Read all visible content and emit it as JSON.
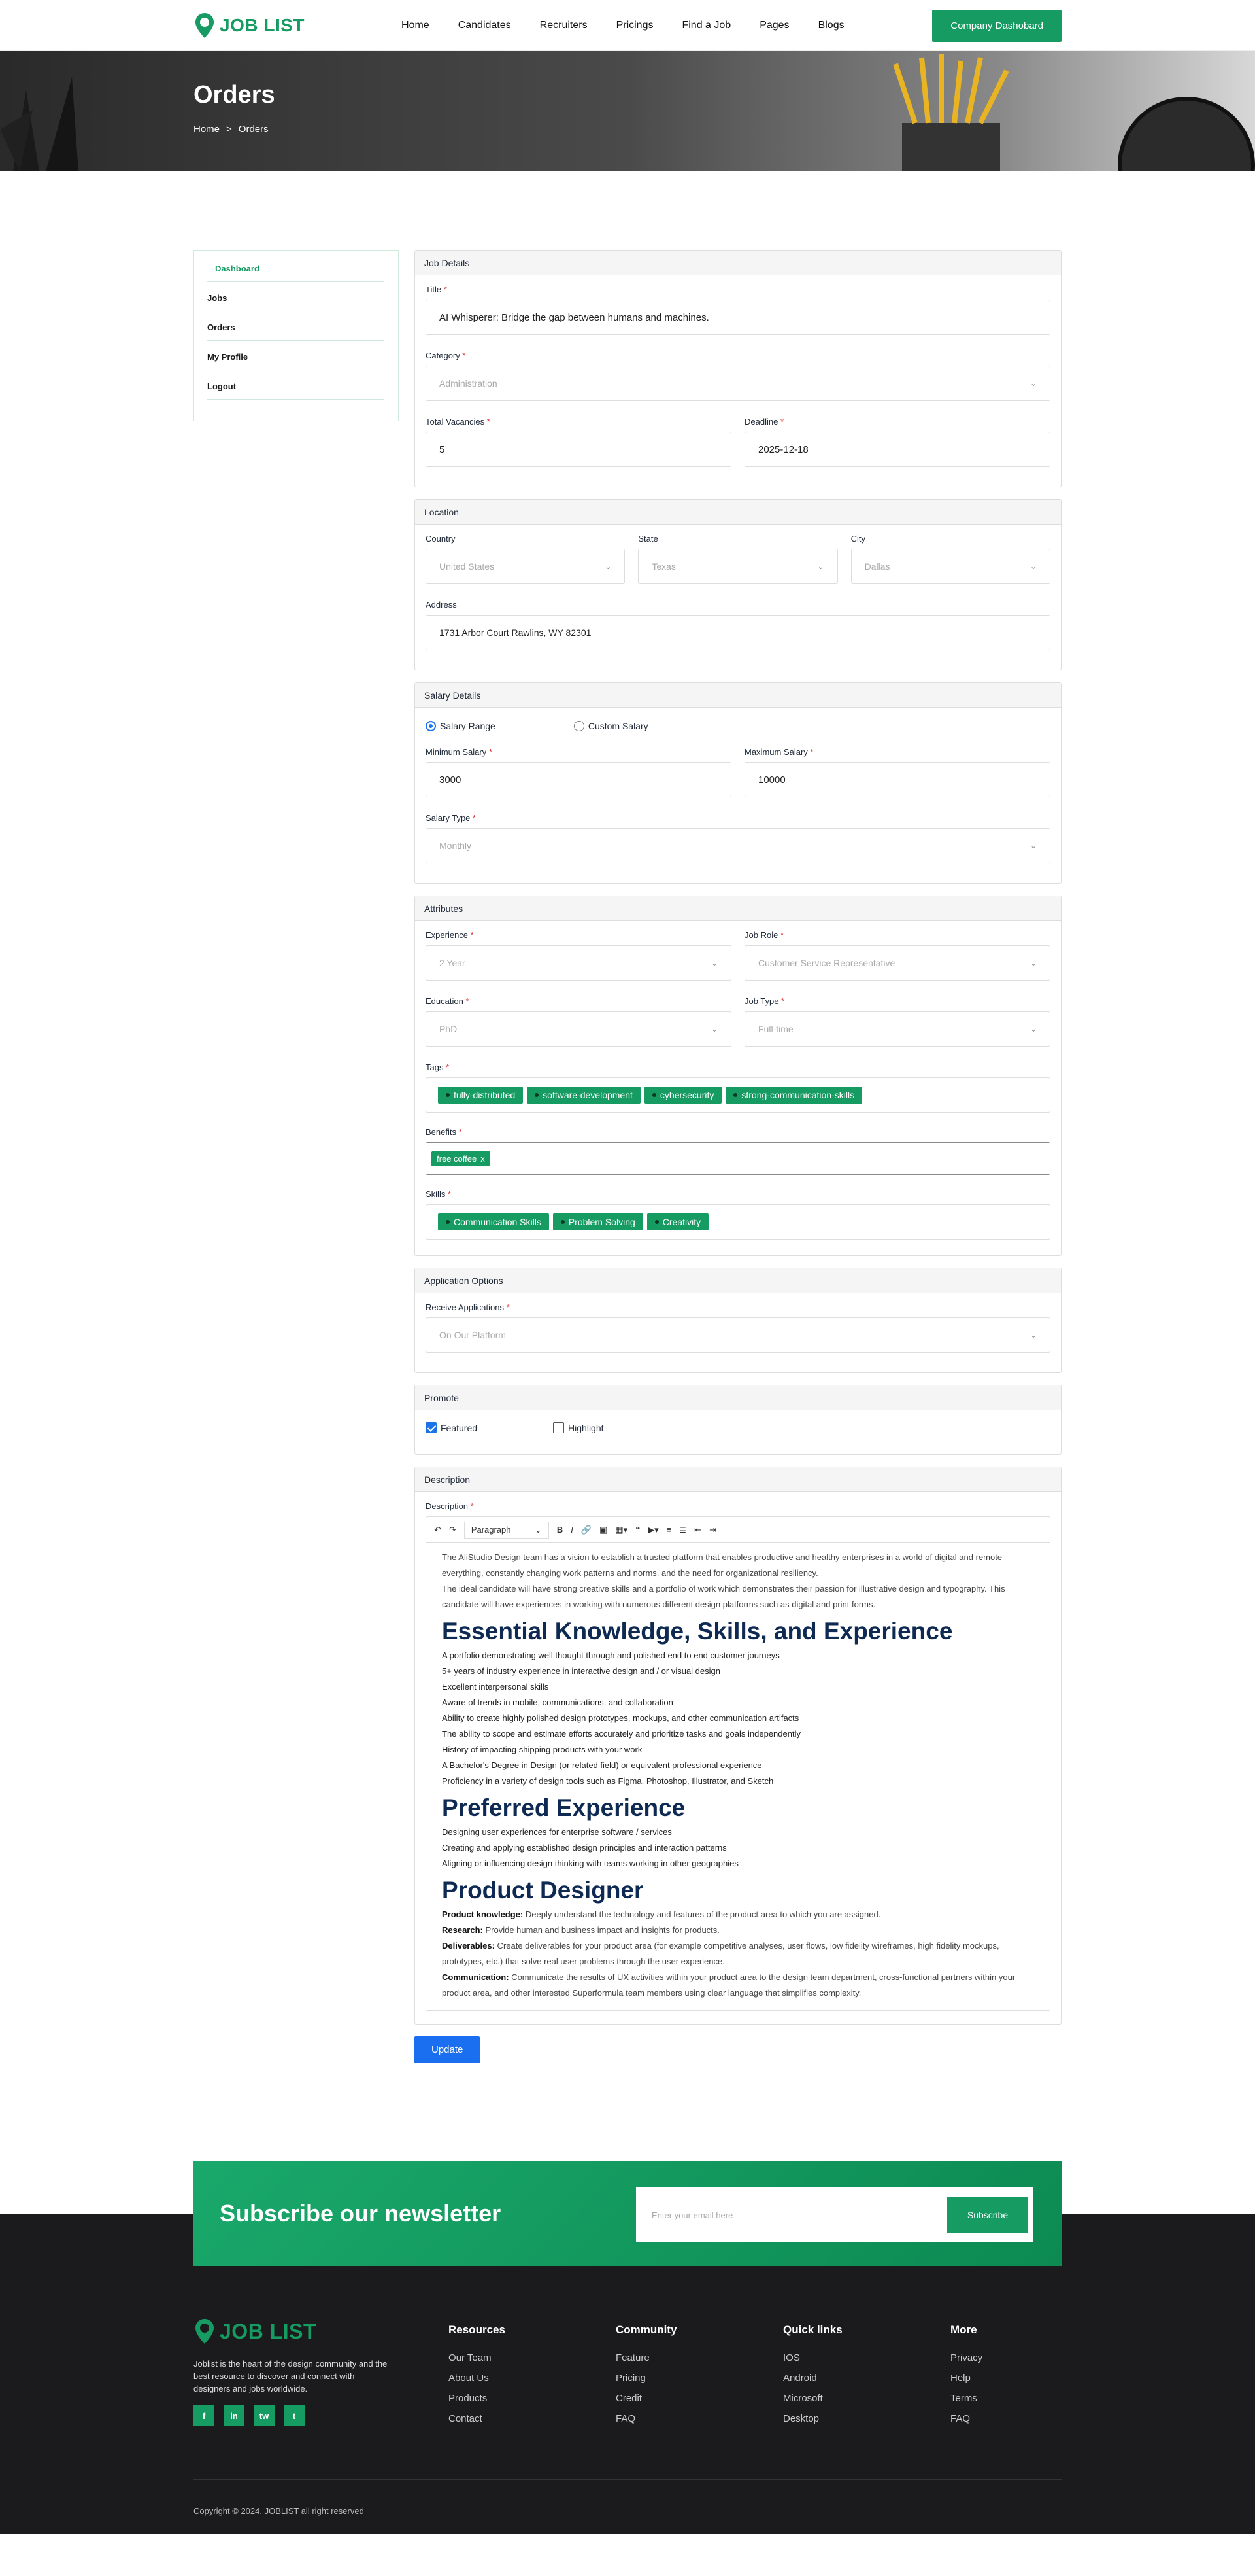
{
  "brand": {
    "name": "JOB LIST"
  },
  "nav": {
    "items": [
      "Home",
      "Candidates",
      "Recruiters",
      "Pricings",
      "Find a Job",
      "Pages",
      "Blogs"
    ],
    "cta": "Company Dashobard"
  },
  "hero": {
    "title": "Orders",
    "crumb_home": "Home",
    "crumb_sep": ">",
    "crumb_current": "Orders"
  },
  "sidebar": {
    "items": [
      "Dashboard",
      "Jobs",
      "Orders",
      "My Profile",
      "Logout"
    ]
  },
  "job_details": {
    "heading": "Job Details",
    "title_label": "Title",
    "title_value": "AI Whisperer: Bridge the gap between humans and machines.",
    "category_label": "Category",
    "category_value": "Administration",
    "vacancies_label": "Total Vacancies",
    "vacancies_value": "5",
    "deadline_label": "Deadline",
    "deadline_value": "2025-12-18"
  },
  "location": {
    "heading": "Location",
    "country_label": "Country",
    "country_value": "United States",
    "state_label": "State",
    "state_value": "Texas",
    "city_label": "City",
    "city_value": "Dallas",
    "address_label": "Address",
    "address_value": "1731 Arbor Court Rawlins, WY 82301"
  },
  "salary": {
    "heading": "Salary Details",
    "opt_range": "Salary Range",
    "opt_custom": "Custom Salary",
    "min_label": "Minimum Salary",
    "min_value": "3000",
    "max_label": "Maximum Salary",
    "max_value": "10000",
    "type_label": "Salary Type",
    "type_value": "Monthly"
  },
  "attributes": {
    "heading": "Attributes",
    "experience_label": "Experience",
    "experience_value": "2 Year",
    "role_label": "Job Role",
    "role_value": "Customer Service Representative",
    "education_label": "Education",
    "education_value": "PhD",
    "jobtype_label": "Job Type",
    "jobtype_value": "Full-time",
    "tags_label": "Tags",
    "tags": [
      "fully-distributed",
      "software-development",
      "cybersecurity",
      "strong-communication-skills"
    ],
    "benefits_label": "Benefits",
    "benefits": [
      "free coffee"
    ],
    "benefit_remove": "x",
    "skills_label": "Skills",
    "skills": [
      "Communication Skills",
      "Problem Solving",
      "Creativity"
    ]
  },
  "application": {
    "heading": "Application Options",
    "receive_label": "Receive Applications",
    "receive_value": "On Our Platform"
  },
  "promote": {
    "heading": "Promote",
    "featured": "Featured",
    "highlight": "Highlight"
  },
  "description": {
    "heading": "Description",
    "label": "Description",
    "toolbar_paragraph": "Paragraph",
    "intro1": "The AliStudio Design team has a vision to establish a trusted platform that enables productive and healthy enterprises in a world of digital and remote everything, constantly changing work patterns and norms, and the need for organizational resiliency.",
    "intro2": "The ideal candidate will have strong creative skills and a portfolio of work which demonstrates their passion for illustrative design and typography. This candidate will have experiences in working with numerous different design platforms such as digital and print forms.",
    "h1": "Essential Knowledge, Skills, and Experience",
    "list1": [
      "A portfolio demonstrating well thought through and polished end to end customer journeys",
      "5+ years of industry experience in interactive design and / or visual design",
      "Excellent interpersonal skills",
      "Aware of trends in mobile, communications, and collaboration",
      "Ability to create highly polished design prototypes, mockups, and other communication artifacts",
      "The ability to scope and estimate efforts accurately and prioritize tasks and goals independently",
      "History of impacting shipping products with your work",
      "A Bachelor's Degree in Design (or related field) or equivalent professional experience",
      "Proficiency in a variety of design tools such as Figma, Photoshop, Illustrator, and Sketch"
    ],
    "h2": "Preferred Experience",
    "list2": [
      "Designing user experiences for enterprise software / services",
      "Creating and applying established design principles and interaction patterns",
      "Aligning or influencing design thinking with teams working in other geographies"
    ],
    "h3": "Product Designer",
    "pk_b": "Product knowledge:",
    "pk": " Deeply understand the technology and features of the product area to which you are assigned.",
    "rs_b": "Research:",
    "rs": " Provide human and business impact and insights for products.",
    "dl_b": "Deliverables:",
    "dl": " Create deliverables for your product area (for example competitive analyses, user flows, low fidelity wireframes, high fidelity mockups, prototypes, etc.) that solve real user problems through the user experience.",
    "cm_b": "Communication:",
    "cm": " Communicate the results of UX activities within your product area to the design team department, cross-functional partners within your product area, and other interested Superformula team members using clear language that simplifies complexity."
  },
  "update_button": "Update",
  "newsletter": {
    "title": "Subscribe our newsletter",
    "placeholder": "Enter your email here",
    "button": "Subscribe"
  },
  "footer": {
    "about": "Joblist is the heart of the design community and the best resource to discover and connect with designers and jobs worldwide.",
    "social": [
      "f",
      "in",
      "tw",
      "t"
    ],
    "cols": [
      {
        "title": "Resources",
        "links": [
          "Our Team",
          "About Us",
          "Products",
          "Contact"
        ]
      },
      {
        "title": "Community",
        "links": [
          "Feature",
          "Pricing",
          "Credit",
          "FAQ"
        ]
      },
      {
        "title": "Quick links",
        "links": [
          "IOS",
          "Android",
          "Microsoft",
          "Desktop"
        ]
      },
      {
        "title": "More",
        "links": [
          "Privacy",
          "Help",
          "Terms",
          "FAQ"
        ]
      }
    ],
    "copyright": "Copyright © 2024. JOBLIST all right reserved"
  }
}
